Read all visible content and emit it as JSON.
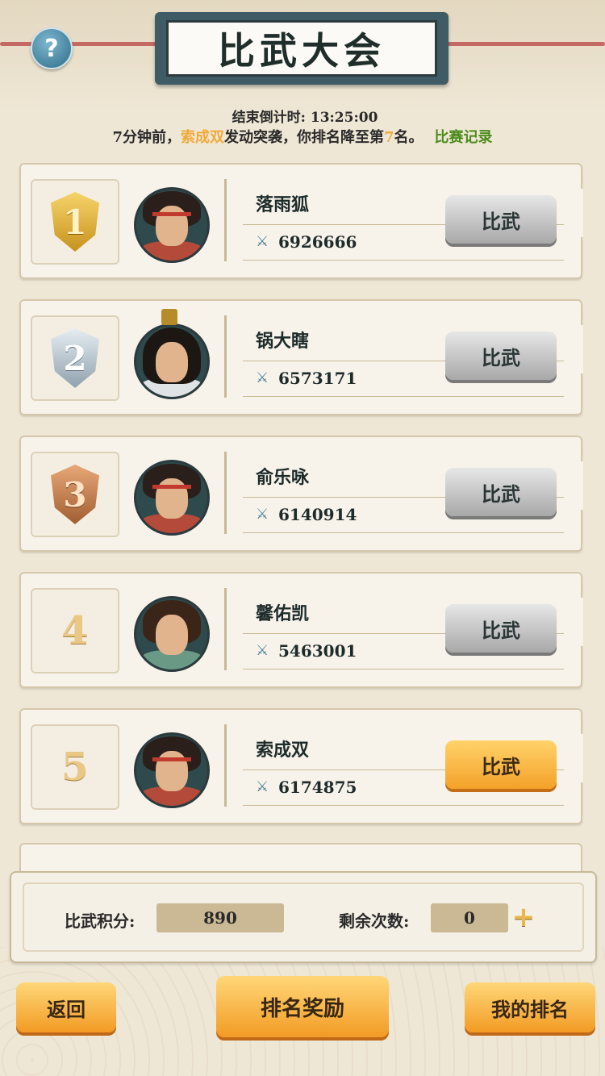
{
  "header": {
    "title": "比武大会",
    "help_icon": "?"
  },
  "countdown": {
    "label": "结束倒计时:",
    "value": "13:25:00"
  },
  "notice": {
    "prefix_num": "7",
    "prefix": "分钟前，",
    "attacker": "索成双",
    "middle": "发动突袭，你排名降至第",
    "rank": "7",
    "suffix": "名。",
    "record_link": "比赛记录"
  },
  "ranking": [
    {
      "rank": "1",
      "medal": "gold",
      "name": "落雨狐",
      "power": "6926666",
      "button": "比武",
      "active": false,
      "avatar": "warrior"
    },
    {
      "rank": "2",
      "medal": "silver",
      "name": "锅大瞎",
      "power": "6573171",
      "button": "比武",
      "active": false,
      "avatar": "scholar"
    },
    {
      "rank": "3",
      "medal": "bronze",
      "name": "俞乐咏",
      "power": "6140914",
      "button": "比武",
      "active": false,
      "avatar": "warrior"
    },
    {
      "rank": "4",
      "medal": "none",
      "name": "馨佑凯",
      "power": "5463001",
      "button": "比武",
      "active": false,
      "avatar": "female"
    },
    {
      "rank": "5",
      "medal": "none",
      "name": "索成双",
      "power": "6174875",
      "button": "比武",
      "active": true,
      "avatar": "warrior"
    }
  ],
  "stats": {
    "score_label": "比武积分:",
    "score_value": "890",
    "remaining_label": "剩余次数:",
    "remaining_value": "0",
    "add_icon": "+"
  },
  "footer": {
    "back": "返回",
    "rewards": "排名奖励",
    "my_rank": "我的排名"
  },
  "colors": {
    "accent_orange": "#f4a129",
    "highlight_text": "#f0a93a",
    "record_link": "#4d8b1c",
    "button_gray": "#a8a8a8"
  }
}
